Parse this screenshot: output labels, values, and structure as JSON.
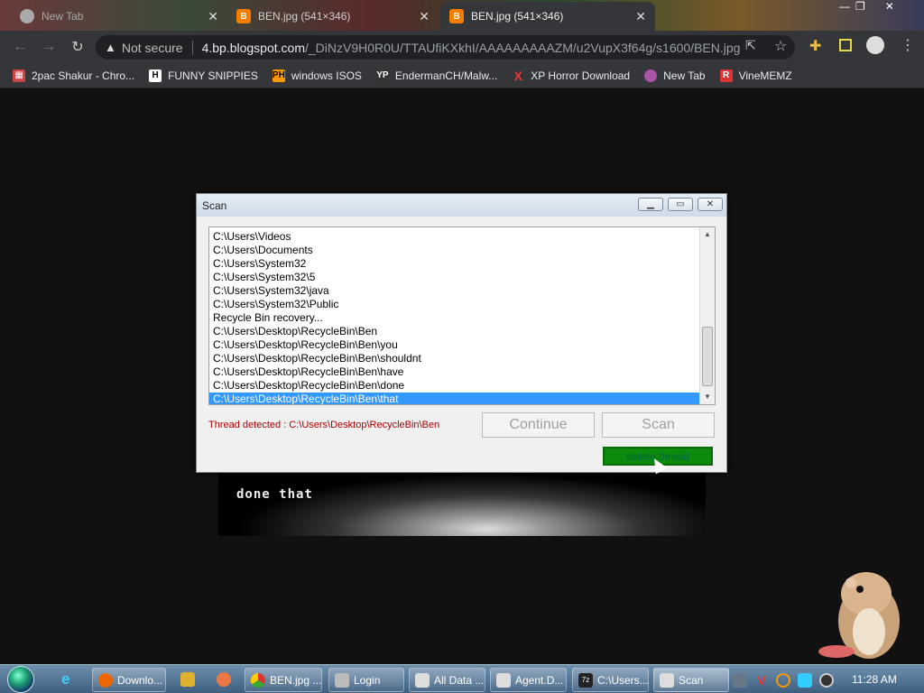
{
  "browser": {
    "tabs": [
      {
        "title": "New Tab",
        "active": false
      },
      {
        "title": "BEN.jpg (541×346)",
        "active": false
      },
      {
        "title": "BEN.jpg (541×346)",
        "active": true
      }
    ],
    "security_label": "Not secure",
    "url_domain": "4.bp.blogspot.com",
    "url_path": "/_DiNzV9H0R0U/TTAUfiKXkhI/AAAAAAAAAZM/u2VupX3f64g/s1600/BEN.jpg",
    "bookmarks": [
      {
        "label": "2pac Shakur - Chro...",
        "icon": "bookmark-photo-icon",
        "color": "#c44"
      },
      {
        "label": "FUNNY SNIPPIES",
        "icon": "bookmark-h-icon",
        "color": "#fff"
      },
      {
        "label": "windows ISOS",
        "icon": "bookmark-ph-icon",
        "color": "#f90"
      },
      {
        "label": "EndermanCH/Malw...",
        "icon": "bookmark-yp-icon",
        "color": "#333"
      },
      {
        "label": "XP Horror Download",
        "icon": "bookmark-x-icon",
        "color": "#e33"
      },
      {
        "label": "New Tab",
        "icon": "bookmark-globe-icon",
        "color": "#a5a"
      },
      {
        "label": "VineMEMZ",
        "icon": "bookmark-r-icon",
        "color": "#d33"
      }
    ]
  },
  "image_caption": "done that",
  "scan_dialog": {
    "title": "Scan",
    "items": [
      "C:\\Users\\Videos",
      "C:\\Users\\Documents",
      "C:\\Users\\System32",
      "C:\\Users\\System32\\5",
      "C:\\Users\\System32\\java",
      "C:\\Users\\System32\\Public",
      "Recycle Bin recovery...",
      "C:\\Users\\Desktop\\RecycleBin\\Ben",
      "C:\\Users\\Desktop\\RecycleBin\\Ben\\you",
      "C:\\Users\\Desktop\\RecycleBin\\Ben\\shouldnt",
      "C:\\Users\\Desktop\\RecycleBin\\Ben\\have",
      "C:\\Users\\Desktop\\RecycleBin\\Ben\\done",
      "C:\\Users\\Desktop\\RecycleBin\\Ben\\that"
    ],
    "selected_index": 12,
    "status": "Thread detected : C:\\Users\\Desktop\\RecycleBin\\Ben",
    "continue_label": "Continue",
    "scan_label": "Scan",
    "delete_label": "delete thread"
  },
  "taskbar": {
    "items": [
      {
        "label": "Downlo...",
        "icon": "firefox-icon",
        "color": "#e60"
      },
      {
        "label": "BEN.jpg ...",
        "icon": "chrome-icon",
        "color": "#4a4"
      },
      {
        "label": "Login",
        "icon": "login-icon",
        "color": "#bbb"
      },
      {
        "label": "All Data ...",
        "icon": "window-icon",
        "color": "#ddd"
      },
      {
        "label": "Agent.D...",
        "icon": "window-icon",
        "color": "#ddd"
      },
      {
        "label": "C:\\Users...",
        "icon": "7zip-icon",
        "color": "#222"
      },
      {
        "label": "Scan",
        "icon": "window-icon",
        "color": "#ddd"
      }
    ],
    "clock": "11:28 AM"
  }
}
